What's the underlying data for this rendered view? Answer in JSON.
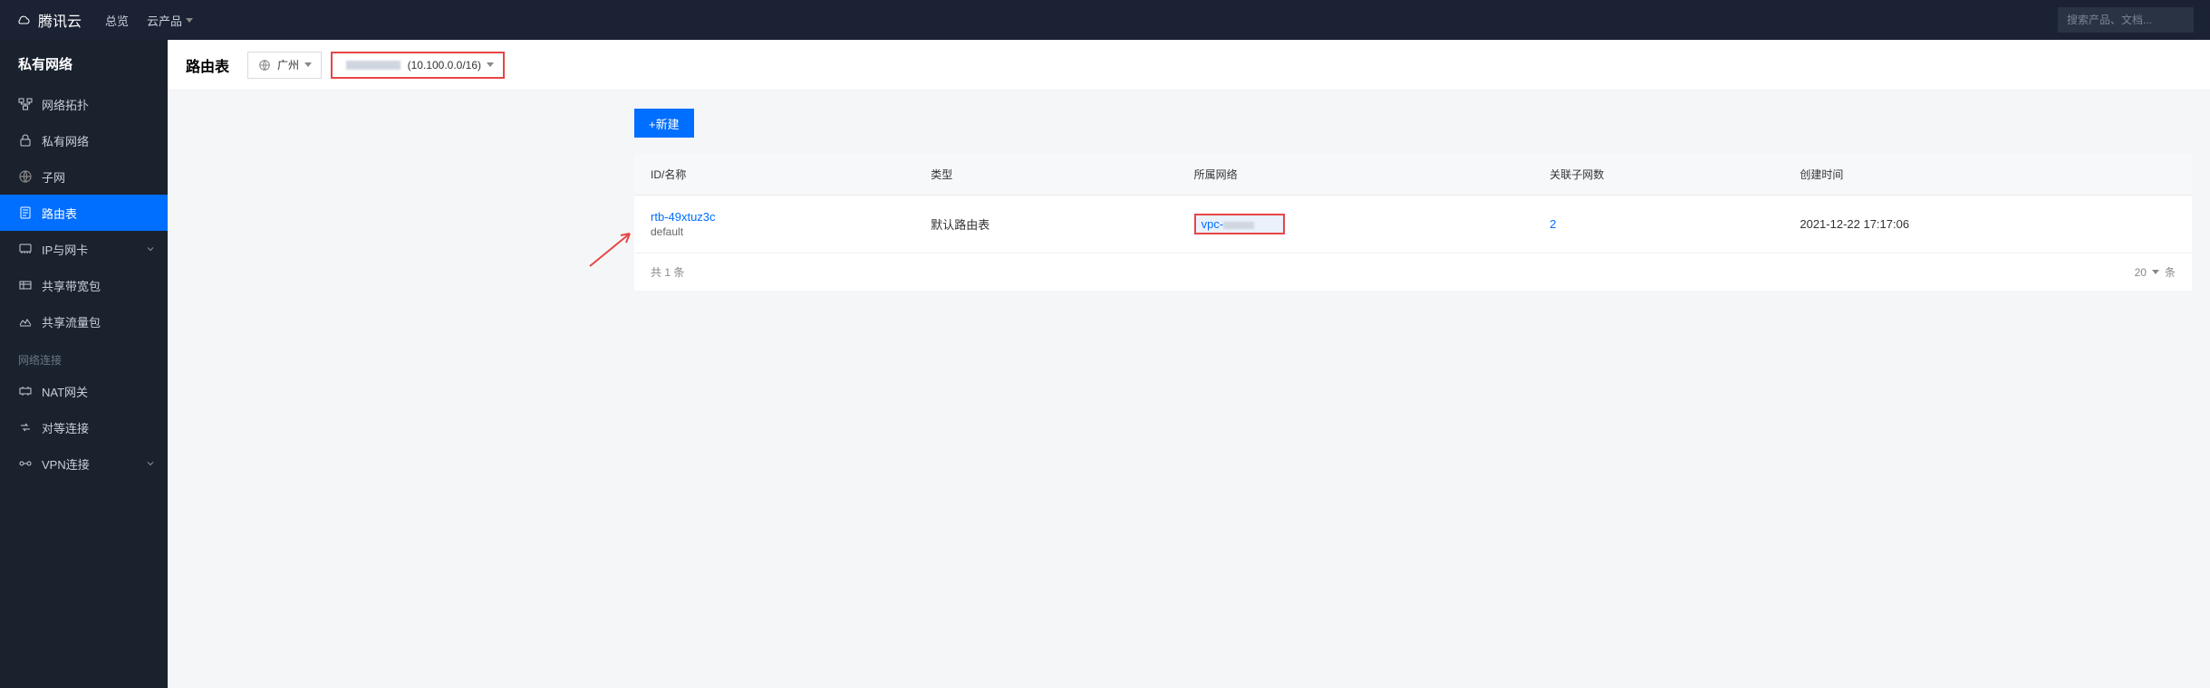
{
  "topnav": {
    "brand": "腾讯云",
    "items": [
      "总览",
      "云产品"
    ],
    "search_placeholder": "搜索产品、文档..."
  },
  "sidebar": {
    "title": "私有网络",
    "items": [
      {
        "label": "网络拓扑",
        "icon": "topology"
      },
      {
        "label": "私有网络",
        "icon": "lock"
      },
      {
        "label": "子网",
        "icon": "globe"
      },
      {
        "label": "路由表",
        "icon": "doc",
        "active": true
      },
      {
        "label": "IP与网卡",
        "icon": "nic",
        "expandable": true
      },
      {
        "label": "共享带宽包",
        "icon": "bwp"
      },
      {
        "label": "共享流量包",
        "icon": "traffic"
      }
    ],
    "group_label": "网络连接",
    "group_items": [
      {
        "label": "NAT网关",
        "icon": "nat"
      },
      {
        "label": "对等连接",
        "icon": "peer"
      },
      {
        "label": "VPN连接",
        "icon": "vpn",
        "expandable": true
      }
    ]
  },
  "page": {
    "title": "路由表",
    "region_label": "广州",
    "vpc_selector_suffix": "(10.100.0.0/16)",
    "new_button": "+新建"
  },
  "table": {
    "headers": [
      "ID/名称",
      "类型",
      "所属网络",
      "关联子网数",
      "创建时间"
    ],
    "rows": [
      {
        "id": "rtb-49xtuz3c",
        "name": "default",
        "type": "默认路由表",
        "vpc_prefix": "vpc-",
        "subnet_count": "2",
        "created": "2021-12-22 17:17:06"
      }
    ],
    "total_prefix": "共",
    "total_count": "1",
    "total_suffix": "条",
    "page_size": "20",
    "page_unit": "条"
  }
}
